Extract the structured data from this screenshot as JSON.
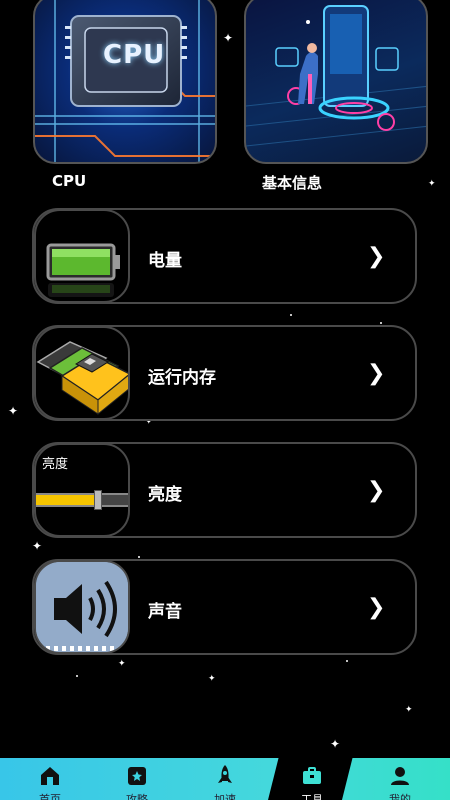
{
  "top_cards": [
    {
      "label": "CPU",
      "image_text": "CPU"
    },
    {
      "label": "基本信息"
    }
  ],
  "rows": [
    {
      "label": "电量",
      "chevron": "❯"
    },
    {
      "label": "运行内存",
      "chevron": "❯"
    },
    {
      "label": "亮度",
      "chevron": "❯",
      "icon_caption": "亮度",
      "slider_level": 0.65
    },
    {
      "label": "声音",
      "chevron": "❯"
    }
  ],
  "nav": {
    "items": [
      {
        "label": "首页",
        "icon": "home-icon"
      },
      {
        "label": "攻略",
        "icon": "star-book-icon"
      },
      {
        "label": "加速",
        "icon": "rocket-icon"
      },
      {
        "label": "工具",
        "icon": "toolbox-icon"
      },
      {
        "label": "我的",
        "icon": "user-icon"
      }
    ],
    "active_index": 3
  },
  "colors": {
    "background": "#000000",
    "nav_gradient_start": "#38c6e8",
    "nav_gradient_end": "#35e0c8",
    "row_border": "#4a4a4a"
  }
}
